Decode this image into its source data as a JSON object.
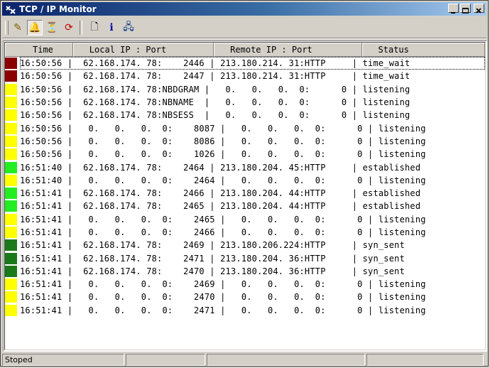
{
  "window": {
    "title": "TCP / IP  Monitor"
  },
  "toolbar": {
    "buttons": [
      {
        "icon": "pencil-icon",
        "glyph": "✎",
        "color": "#806000"
      },
      {
        "icon": "bell-icon",
        "glyph": "🔔",
        "color": "#c0a000"
      },
      {
        "icon": "filter-icon",
        "glyph": "⏳",
        "color": "#404000"
      },
      {
        "icon": "refresh-icon",
        "glyph": "⟳",
        "color": "#c00000"
      },
      {
        "icon": "document-icon",
        "glyph": "🗋",
        "color": "#000"
      },
      {
        "icon": "info-icon",
        "glyph": "ℹ",
        "color": "#0000a0"
      },
      {
        "icon": "network-icon",
        "glyph": "🖧",
        "color": "#003080"
      }
    ]
  },
  "columns": {
    "time": "Time",
    "local": "Local IP : Port",
    "remote": "Remote IP : Port",
    "status": "Status"
  },
  "colors": {
    "time_wait": "#8b0000",
    "listening": "#ffff00",
    "established": "#22ee22",
    "syn_sent": "#1a7a1a"
  },
  "rows": [
    {
      "state": "time_wait",
      "text": "16:50:56 |  62.168.174. 78:    2446 | 213.180.214. 31:HTTP     | time_wait"
    },
    {
      "state": "time_wait",
      "text": "16:50:56 |  62.168.174. 78:    2447 | 213.180.214. 31:HTTP     | time_wait"
    },
    {
      "state": "listening",
      "text": "16:50:56 |  62.168.174. 78:NBDGRAM |   0.   0.   0.  0:      0 | listening"
    },
    {
      "state": "listening",
      "text": "16:50:56 |  62.168.174. 78:NBNAME  |   0.   0.   0.  0:      0 | listening"
    },
    {
      "state": "listening",
      "text": "16:50:56 |  62.168.174. 78:NBSESS  |   0.   0.   0.  0:      0 | listening"
    },
    {
      "state": "listening",
      "text": "16:50:56 |   0.   0.   0.  0:    8087 |   0.   0.   0.  0:      0 | listening"
    },
    {
      "state": "listening",
      "text": "16:50:56 |   0.   0.   0.  0:    8086 |   0.   0.   0.  0:      0 | listening"
    },
    {
      "state": "listening",
      "text": "16:50:56 |   0.   0.   0.  0:    1026 |   0.   0.   0.  0:      0 | listening"
    },
    {
      "state": "established",
      "text": "16:51:40 |  62.168.174. 78:    2464 | 213.180.204. 45:HTTP     | established"
    },
    {
      "state": "listening",
      "text": "16:51:40 |   0.   0.   0.  0:    2464 |   0.   0.   0.  0:      0 | listening"
    },
    {
      "state": "established",
      "text": "16:51:41 |  62.168.174. 78:    2466 | 213.180.204. 44:HTTP     | established"
    },
    {
      "state": "established",
      "text": "16:51:41 |  62.168.174. 78:    2465 | 213.180.204. 44:HTTP     | established"
    },
    {
      "state": "listening",
      "text": "16:51:41 |   0.   0.   0.  0:    2465 |   0.   0.   0.  0:      0 | listening"
    },
    {
      "state": "listening",
      "text": "16:51:41 |   0.   0.   0.  0:    2466 |   0.   0.   0.  0:      0 | listening"
    },
    {
      "state": "syn_sent",
      "text": "16:51:41 |  62.168.174. 78:    2469 | 213.180.206.224:HTTP     | syn_sent"
    },
    {
      "state": "syn_sent",
      "text": "16:51:41 |  62.168.174. 78:    2471 | 213.180.204. 36:HTTP     | syn_sent"
    },
    {
      "state": "syn_sent",
      "text": "16:51:41 |  62.168.174. 78:    2470 | 213.180.204. 36:HTTP     | syn_sent"
    },
    {
      "state": "listening",
      "text": "16:51:41 |   0.   0.   0.  0:    2469 |   0.   0.   0.  0:      0 | listening"
    },
    {
      "state": "listening",
      "text": "16:51:41 |   0.   0.   0.  0:    2470 |   0.   0.   0.  0:      0 | listening"
    },
    {
      "state": "listening",
      "text": "16:51:41 |   0.   0.   0.  0:    2471 |   0.   0.   0.  0:      0 | listening"
    }
  ],
  "statusbar": {
    "text": "Stoped"
  }
}
